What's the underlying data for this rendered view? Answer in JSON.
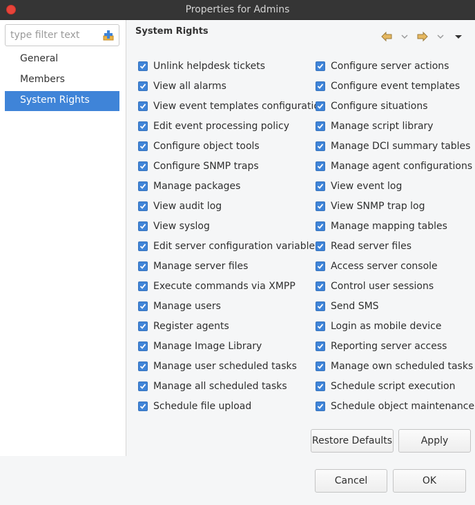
{
  "window": {
    "title": "Properties for Admins"
  },
  "filter": {
    "placeholder": "type filter text"
  },
  "nav": {
    "items": [
      {
        "label": "General"
      },
      {
        "label": "Members"
      },
      {
        "label": "System Rights"
      }
    ],
    "selected": "System Rights"
  },
  "section": {
    "title": "System Rights"
  },
  "toolbar": {
    "icons": [
      "back-arrow-icon",
      "back-dropdown-icon",
      "forward-arrow-icon",
      "forward-dropdown-icon",
      "view-menu-icon"
    ]
  },
  "rights": {
    "left": [
      "Unlink helpdesk tickets",
      "View all alarms",
      "View event templates configuration",
      "Edit event processing policy",
      "Configure object tools",
      "Configure SNMP traps",
      "Manage packages",
      "View audit log",
      "View syslog",
      "Edit server configuration variables",
      "Manage server files",
      "Execute commands via XMPP",
      "Manage users",
      "Register agents",
      "Manage Image Library",
      "Manage user scheduled tasks",
      "Manage all scheduled tasks",
      "Schedule file upload"
    ],
    "right": [
      "Configure server actions",
      "Configure event templates",
      "Configure situations",
      "Manage script library",
      "Manage DCI summary tables",
      "Manage agent configurations",
      "View event log",
      "View SNMP trap log",
      "Manage mapping tables",
      "Read server files",
      "Access server console",
      "Control user sessions",
      "Send SMS",
      "Login as mobile device",
      "Reporting server access",
      "Manage own scheduled tasks",
      "Schedule script execution",
      "Schedule object maintenance"
    ],
    "all_checked": true
  },
  "buttons": {
    "restore_defaults": "Restore Defaults",
    "apply": "Apply",
    "cancel": "Cancel",
    "ok": "OK"
  },
  "colors": {
    "accent": "#3f84d8",
    "close": "#e7443a"
  }
}
